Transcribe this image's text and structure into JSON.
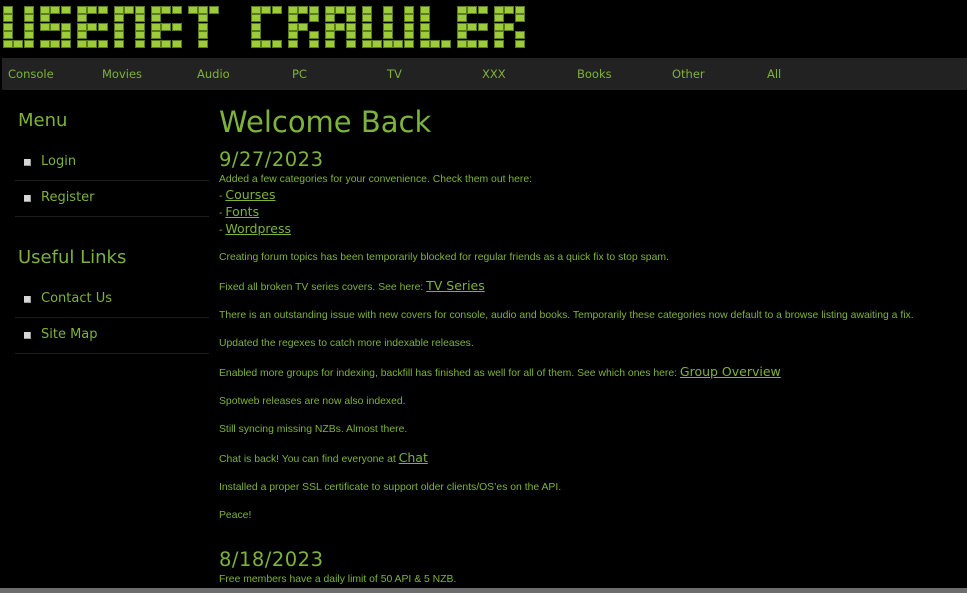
{
  "site": {
    "logo_text": "USENET CRAWLER",
    "brand_color": "#9ccc3c",
    "text_color": "#7db33a",
    "nav_bg": "#222222"
  },
  "nav": {
    "items": [
      {
        "label": "Console"
      },
      {
        "label": "Movies"
      },
      {
        "label": "Audio"
      },
      {
        "label": "PC"
      },
      {
        "label": "TV"
      },
      {
        "label": "XXX"
      },
      {
        "label": "Books"
      },
      {
        "label": "Other"
      },
      {
        "label": "All"
      }
    ]
  },
  "sidebar": {
    "menu_title": "Menu",
    "menu_items": [
      {
        "label": "Login"
      },
      {
        "label": "Register"
      }
    ],
    "links_title": "Useful Links",
    "link_items": [
      {
        "label": "Contact Us"
      },
      {
        "label": "Site Map"
      }
    ]
  },
  "main": {
    "title": "Welcome Back",
    "news": [
      {
        "date": "9/27/2023",
        "intro": "Added a few categories for your convenience. Check them out here:",
        "category_links": [
          {
            "prefix": "- ",
            "label": "Courses"
          },
          {
            "prefix": "- ",
            "label": "Fonts"
          },
          {
            "prefix": "- ",
            "label": "Wordpress"
          }
        ],
        "p_forum": "Creating forum topics has been temporarily blocked for regular friends as a quick fix to stop spam.",
        "p_tv": "Fixed all broken TV series covers. See here: ",
        "p_tv_link": "TV Series",
        "p_covers": "There is an outstanding issue with new covers for console, audio and books. Temporarily these categories now default to a browse listing awaiting a fix.",
        "p_regex": "Updated the regexes to catch more indexable releases.",
        "p_groups": "Enabled more groups for indexing, backfill has finished as well for all of them. See which ones here: ",
        "p_groups_link": "Group Overview",
        "p_spotweb": "Spotweb releases are now also indexed.",
        "p_sync": "Still syncing missing NZBs. Almost there.",
        "p_chat": "Chat is back! You can find everyone at ",
        "p_chat_link": "Chat",
        "p_ssl": "Installed a proper SSL certificate to support older clients/OS’es on the API.",
        "p_peace": "Peace!"
      },
      {
        "date": "8/18/2023",
        "p_limit": "Free members have a daily limit of 50 API & 5 NZB."
      }
    ]
  }
}
